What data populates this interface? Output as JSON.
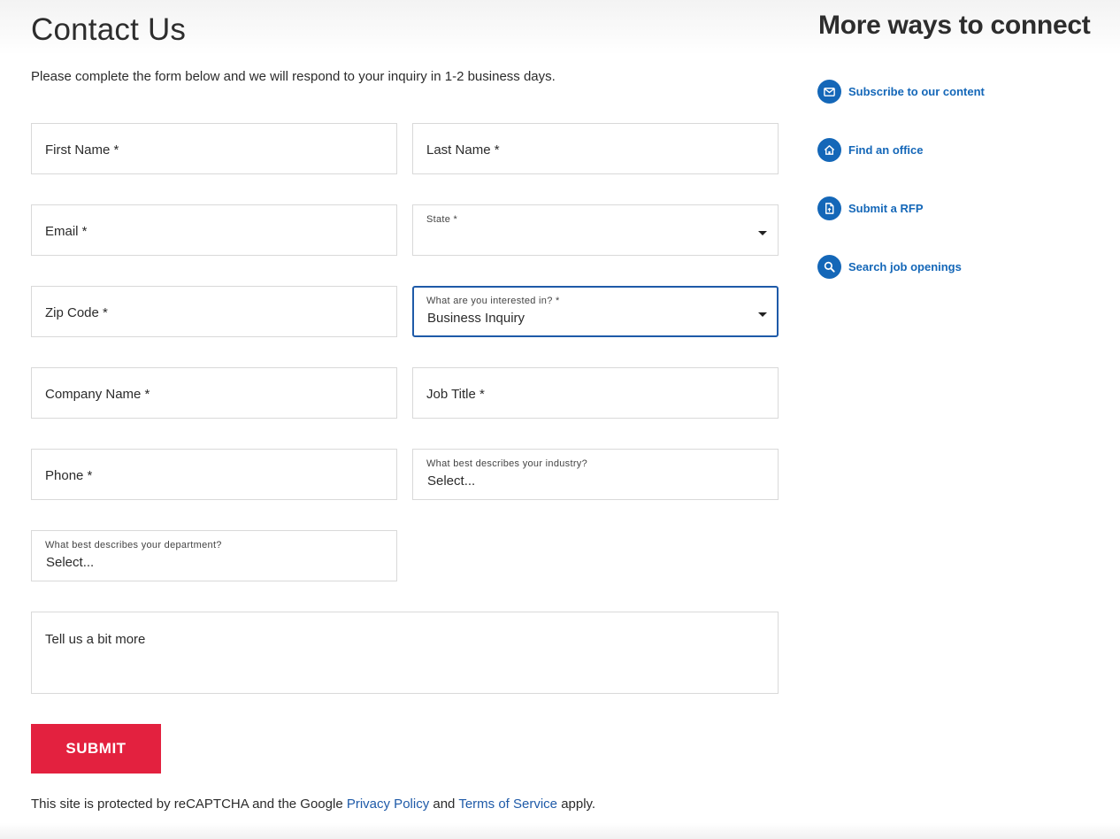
{
  "form": {
    "title": "Contact Us",
    "intro": "Please complete the form below and we will respond to your inquiry in 1-2 business days.",
    "first_name": "First Name *",
    "last_name": "Last Name *",
    "email": "Email *",
    "state_label": "State *",
    "zip": "Zip Code *",
    "interest_label": "What are you interested in? *",
    "interest_value": "Business Inquiry",
    "company": "Company Name *",
    "job_title": "Job Title *",
    "phone": "Phone *",
    "industry_label": "What best describes your industry?",
    "industry_value": "Select...",
    "department_label": "What best describes your department?",
    "department_value": "Select...",
    "message": "Tell us a bit more",
    "submit": "SUBMIT"
  },
  "legal": {
    "prefix": "This site is protected by reCAPTCHA and the Google",
    "privacy": "Privacy Policy",
    "and": "and",
    "terms": "Terms of Service",
    "suffix": "apply."
  },
  "sidebar": {
    "title": "More ways to connect",
    "links": [
      {
        "label": "Subscribe to our content",
        "icon": "mail-icon"
      },
      {
        "label": "Find an office",
        "icon": "home-icon"
      },
      {
        "label": "Submit a RFP",
        "icon": "document-icon"
      },
      {
        "label": "Search job openings",
        "icon": "search-icon"
      }
    ]
  },
  "colors": {
    "accent_blue": "#1467b8",
    "submit_red": "#e3213f",
    "focus_border": "#1e5aa8"
  }
}
